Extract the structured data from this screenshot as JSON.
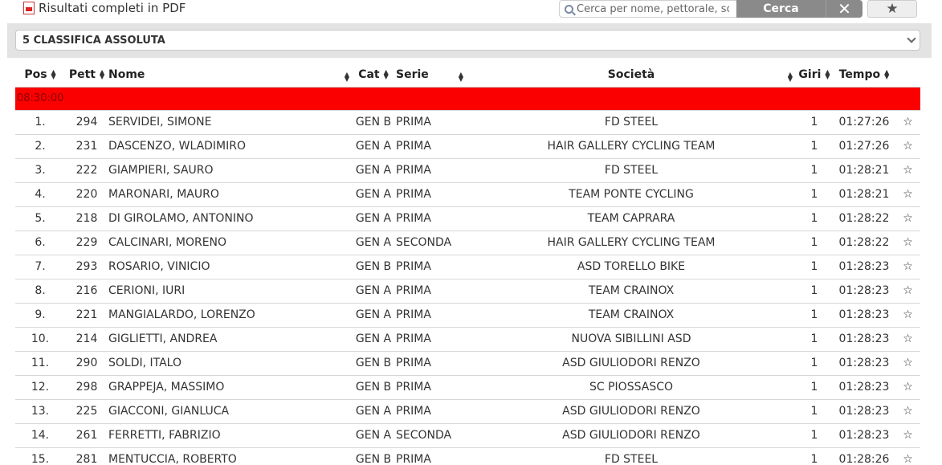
{
  "toolbar": {
    "pdf_label": "Risultati completi in PDF",
    "search_placeholder": "Cerca per nome, pettorale, società",
    "search_button": "Cerca",
    "clear_button": "✕",
    "favorite_button": "★"
  },
  "race_select": {
    "selected": "5 CLASSIFICA ASSOLUTA"
  },
  "table": {
    "headers": {
      "pos": "Pos",
      "pett": "Pett",
      "nome": "Nome",
      "cat": "Cat",
      "serie": "Serie",
      "societa": "Società",
      "giri": "Giri",
      "tempo": "Tempo"
    },
    "group_label": "08:30:00",
    "rows": [
      {
        "pos": "1.",
        "pett": "294",
        "nome": "SERVIDEI, SIMONE",
        "cat": "GEN B",
        "serie": "PRIMA",
        "societa": "FD STEEL",
        "giri": "1",
        "tempo": "01:27:26"
      },
      {
        "pos": "2.",
        "pett": "231",
        "nome": "DASCENZO, WLADIMIRO",
        "cat": "GEN A",
        "serie": "PRIMA",
        "societa": "HAIR GALLERY CYCLING TEAM",
        "giri": "1",
        "tempo": "01:27:26"
      },
      {
        "pos": "3.",
        "pett": "222",
        "nome": "GIAMPIERI, SAURO",
        "cat": "GEN A",
        "serie": "PRIMA",
        "societa": "FD STEEL",
        "giri": "1",
        "tempo": "01:28:21"
      },
      {
        "pos": "4.",
        "pett": "220",
        "nome": "MARONARI, MAURO",
        "cat": "GEN A",
        "serie": "PRIMA",
        "societa": "TEAM PONTE CYCLING",
        "giri": "1",
        "tempo": "01:28:21"
      },
      {
        "pos": "5.",
        "pett": "218",
        "nome": "DI GIROLAMO, ANTONINO",
        "cat": "GEN A",
        "serie": "PRIMA",
        "societa": "TEAM CAPRARA",
        "giri": "1",
        "tempo": "01:28:22"
      },
      {
        "pos": "6.",
        "pett": "229",
        "nome": "CALCINARI, MORENO",
        "cat": "GEN A",
        "serie": "SECONDA",
        "societa": "HAIR GALLERY CYCLING TEAM",
        "giri": "1",
        "tempo": "01:28:22"
      },
      {
        "pos": "7.",
        "pett": "293",
        "nome": "ROSARIO, VINICIO",
        "cat": "GEN B",
        "serie": "PRIMA",
        "societa": "ASD TORELLO BIKE",
        "giri": "1",
        "tempo": "01:28:23"
      },
      {
        "pos": "8.",
        "pett": "216",
        "nome": "CERIONI, IURI",
        "cat": "GEN A",
        "serie": "PRIMA",
        "societa": "TEAM CRAINOX",
        "giri": "1",
        "tempo": "01:28:23"
      },
      {
        "pos": "9.",
        "pett": "221",
        "nome": "MANGIALARDO, LORENZO",
        "cat": "GEN A",
        "serie": "PRIMA",
        "societa": "TEAM CRAINOX",
        "giri": "1",
        "tempo": "01:28:23"
      },
      {
        "pos": "10.",
        "pett": "214",
        "nome": "GIGLIETTI, ANDREA",
        "cat": "GEN A",
        "serie": "PRIMA",
        "societa": "NUOVA SIBILLINI ASD",
        "giri": "1",
        "tempo": "01:28:23"
      },
      {
        "pos": "11.",
        "pett": "290",
        "nome": "SOLDI, ITALO",
        "cat": "GEN B",
        "serie": "PRIMA",
        "societa": "ASD GIULIODORI RENZO",
        "giri": "1",
        "tempo": "01:28:23"
      },
      {
        "pos": "12.",
        "pett": "298",
        "nome": "GRAPPEJA, MASSIMO",
        "cat": "GEN B",
        "serie": "PRIMA",
        "societa": "SC PIOSSASCO",
        "giri": "1",
        "tempo": "01:28:23"
      },
      {
        "pos": "13.",
        "pett": "225",
        "nome": "GIACCONI, GIANLUCA",
        "cat": "GEN A",
        "serie": "PRIMA",
        "societa": "ASD GIULIODORI RENZO",
        "giri": "1",
        "tempo": "01:28:23"
      },
      {
        "pos": "14.",
        "pett": "261",
        "nome": "FERRETTI, FABRIZIO",
        "cat": "GEN A",
        "serie": "SECONDA",
        "societa": "ASD GIULIODORI RENZO",
        "giri": "1",
        "tempo": "01:28:23"
      },
      {
        "pos": "15.",
        "pett": "281",
        "nome": "MENTUCCIA, ROBERTO",
        "cat": "GEN B",
        "serie": "PRIMA",
        "societa": "FD STEEL",
        "giri": "1",
        "tempo": "01:28:26"
      }
    ],
    "row_star": "☆"
  },
  "colors": {
    "group_row": "#fa0000",
    "button_gray": "#8a8a8a",
    "select_band": "#e3e3e3"
  }
}
